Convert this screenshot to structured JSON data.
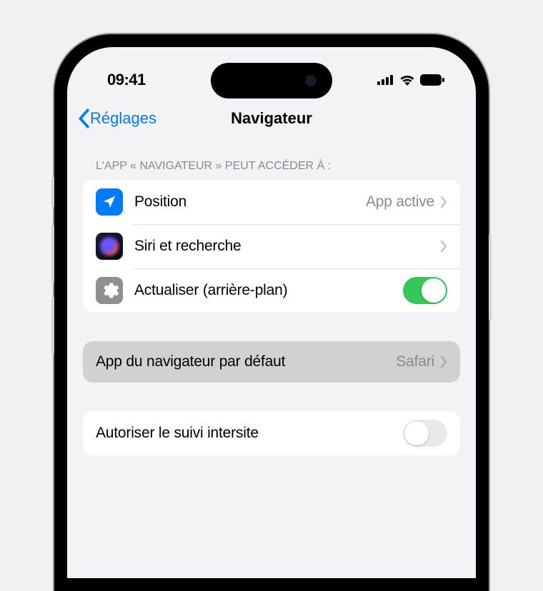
{
  "statusBar": {
    "time": "09:41"
  },
  "nav": {
    "back": "Réglages",
    "title": "Navigateur"
  },
  "section1": {
    "header": "L'app « Navigateur » peut accéder à :",
    "rows": {
      "location": {
        "label": "Position",
        "value": "App active"
      },
      "siri": {
        "label": "Siri et recherche"
      },
      "refresh": {
        "label": "Actualiser (arrière-plan)",
        "toggle": true
      }
    }
  },
  "section2": {
    "defaultBrowser": {
      "label": "App du navigateur par défaut",
      "value": "Safari"
    }
  },
  "section3": {
    "crossSite": {
      "label": "Autoriser le suivi intersite",
      "toggle": false
    }
  }
}
